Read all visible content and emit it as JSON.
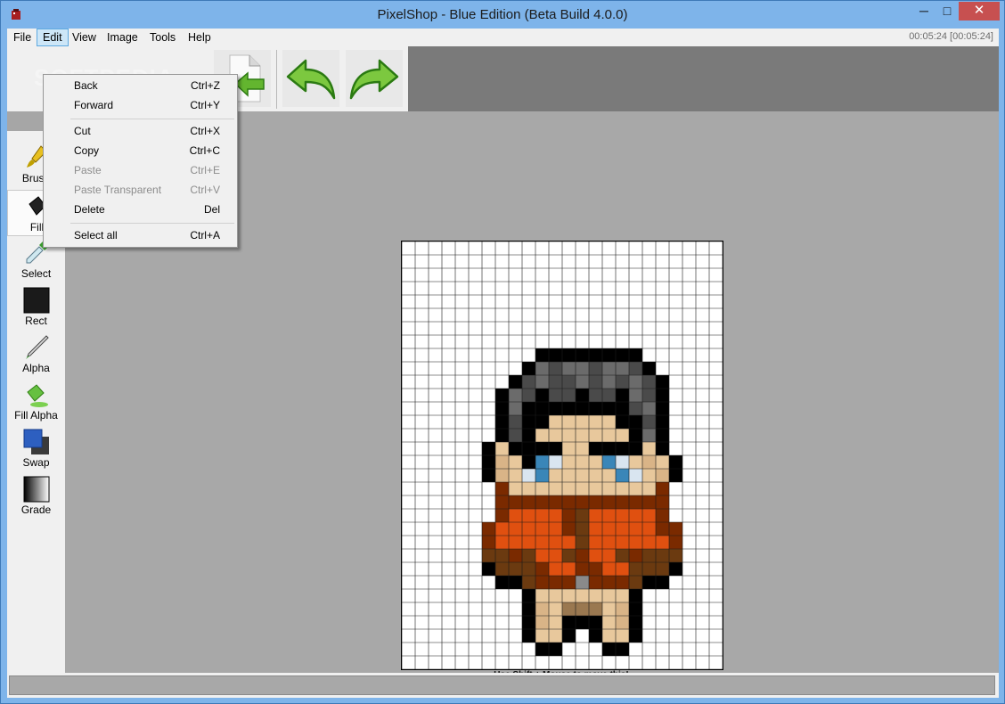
{
  "window": {
    "title": "PixelShop - Blue Edition (Beta Build 4.0.0)",
    "minimize_glyph": "─",
    "maximize_glyph": "□",
    "close_glyph": "✕"
  },
  "menubar": {
    "items": [
      "File",
      "Edit",
      "View",
      "Image",
      "Tools",
      "Help"
    ],
    "active": "Edit",
    "timer": "00:05:24 [00:05:24]"
  },
  "edit_menu": {
    "items": [
      {
        "label": "Back",
        "shortcut": "Ctrl+Z",
        "enabled": true
      },
      {
        "label": "Forward",
        "shortcut": "Ctrl+Y",
        "enabled": true
      },
      {
        "label": "Cut",
        "shortcut": "Ctrl+X",
        "enabled": true
      },
      {
        "label": "Copy",
        "shortcut": "Ctrl+C",
        "enabled": true
      },
      {
        "label": "Paste",
        "shortcut": "Ctrl+E",
        "enabled": false
      },
      {
        "label": "Paste Transparent",
        "shortcut": "Ctrl+V",
        "enabled": false
      },
      {
        "label": "Delete",
        "shortcut": "Del",
        "enabled": true
      },
      {
        "label": "Select all",
        "shortcut": "Ctrl+A",
        "enabled": true
      }
    ]
  },
  "tools": [
    {
      "label": "Brush",
      "icon": "brush-icon"
    },
    {
      "label": "Fill",
      "icon": "fill-bucket-icon",
      "selected": true
    },
    {
      "label": "Select",
      "icon": "eyedropper-icon"
    },
    {
      "label": "Rect",
      "icon": "rectangle-icon"
    },
    {
      "label": "Alpha",
      "icon": "alpha-pen-icon"
    },
    {
      "label": "Fill Alpha",
      "icon": "fill-alpha-icon"
    },
    {
      "label": "Swap",
      "icon": "swap-colors-icon"
    },
    {
      "label": "Grade",
      "icon": "gradient-icon"
    }
  ],
  "toolbar": {
    "icons": [
      "new-page-arrow-icon",
      "undo-arrow-icon",
      "redo-arrow-icon"
    ]
  },
  "canvas": {
    "hint": "Use Shift + Mouse to move this!",
    "grid_cols": 24,
    "grid_rows": 32,
    "palette": {
      "K": "#000000",
      "D": "#4a4a4a",
      "G": "#6b6b6b",
      "S": "#e8c89c",
      "s": "#d9b487",
      "W": "#d9e5f0",
      "B": "#3a86b8",
      "R": "#7a2a00",
      "O": "#e05010",
      "N": "#6b3a10",
      "g": "#8a8a8a",
      "M": "#9a7850"
    },
    "pixels": [
      "........................",
      "........................",
      "........................",
      "........................",
      "........................",
      "........................",
      "........................",
      "........................",
      "..........KKKKKKKK......",
      ".........KGDGGDGGDK.....",
      "........KDGDDGDGDGDK....",
      ".......KGDKDDKDDKGDK....",
      ".......KGKKKKKKKKDGK....",
      ".......KDKKSSSSSKKDK....",
      ".......KDKSSSSSSSKGK....",
      "......KSKKKKSSKKKKSK....",
      "......KsSKBWSSSBWSsSK...",
      "......KsSWBSSSSSBWSsK...",
      ".......RSSSSSSSSSSSR....",
      ".......RRRRRRRRRRRRR....",
      ".......ROOOORNOOOOOR....",
      "......ROOOOORNOOOOORR...",
      "......ROOOOOONOOOOOOR...",
      "......NNRNOONROONRNNN...",
      "......KNNNROORROONNNK...",
      ".......KKNRRRgRRRNKK....",
      ".........KSSSSSSSK......",
      ".........KsSMMMSsK......",
      ".........KsSKKKSsK......",
      ".........KSSK.KSSK......",
      "..........KK...KK.......",
      "........................"
    ]
  }
}
